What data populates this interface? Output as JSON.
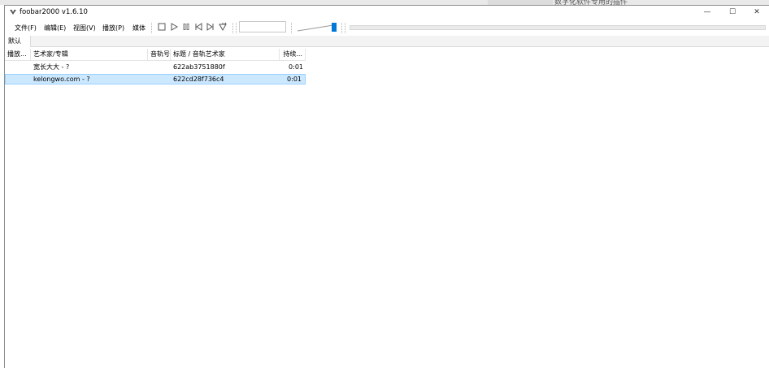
{
  "background": {
    "title": "数字化软件专用的插件"
  },
  "window": {
    "title": "foobar2000 v1.6.10",
    "controls": {
      "minimize": "—",
      "maximize": "☐",
      "close": "✕"
    }
  },
  "menu": {
    "file": "文件(F)",
    "edit": "编辑(E)",
    "view": "视图(V)",
    "playback": "播放(P)",
    "library": "媒体"
  },
  "tabs": [
    {
      "label": "默认"
    }
  ],
  "playlist": {
    "columns": {
      "playing": "播放...",
      "artist_album": "艺术家/专辑",
      "track_no": "音轨号",
      "title_artist": "标题 / 音轨艺术家",
      "duration": "持续..."
    },
    "rows": [
      {
        "artist_album": "宽长大大 - ?",
        "track_no": "",
        "title": "622ab3751880f",
        "duration": "0:01"
      },
      {
        "artist_album": "kelongwo.com - ?",
        "track_no": "",
        "title": "622cd28f736c4",
        "duration": "0:01"
      }
    ]
  },
  "volume_level": 1.0,
  "seek_progress": 0.0,
  "colors": {
    "selection": "#cce8ff",
    "selection_border": "#99d1ff",
    "volume_thumb": "#0078d7"
  }
}
